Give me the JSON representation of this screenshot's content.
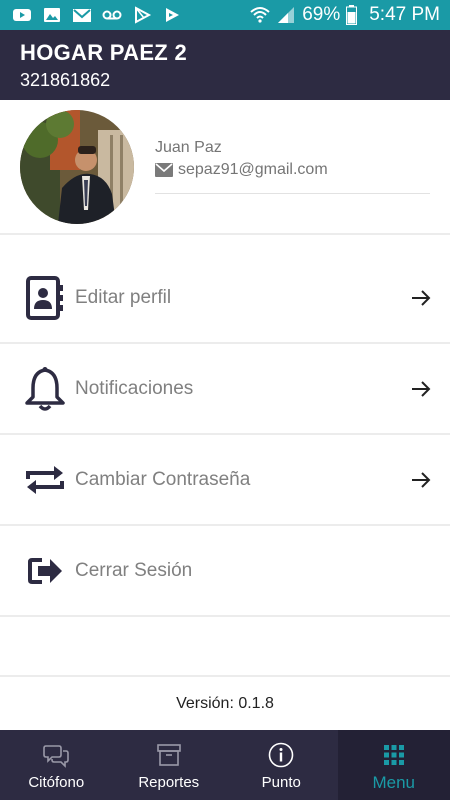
{
  "status_bar": {
    "battery": "69%",
    "time": "5:47 PM",
    "icons": [
      "youtube-icon",
      "image-icon",
      "gmail-icon",
      "voicemail-icon",
      "play-store-icon",
      "play-store-alt-icon",
      "wifi-icon",
      "signal-icon",
      "battery-icon"
    ]
  },
  "header": {
    "title": "HOGAR PAEZ 2",
    "subtitle": "321861862"
  },
  "profile": {
    "name": "Juan Paz",
    "email": "sepaz91@gmail.com"
  },
  "menu": {
    "items": [
      {
        "label": "Editar perfil",
        "icon": "contact-book-icon",
        "has_arrow": true
      },
      {
        "label": "Notificaciones",
        "icon": "bell-icon",
        "has_arrow": true
      },
      {
        "label": "Cambiar Contraseña",
        "icon": "swap-arrows-icon",
        "has_arrow": true
      },
      {
        "label": "Cerrar Sesión",
        "icon": "sign-out-icon",
        "has_arrow": false
      }
    ]
  },
  "version": "Versión: 0.1.8",
  "bottom_nav": {
    "items": [
      {
        "label": "Citófono",
        "icon": "chat-bubbles-icon",
        "active": false
      },
      {
        "label": "Reportes",
        "icon": "archive-box-icon",
        "active": false
      },
      {
        "label": "Punto",
        "icon": "info-circle-icon",
        "active": false
      },
      {
        "label": "Menu",
        "icon": "grid-icon",
        "active": true
      }
    ]
  },
  "colors": {
    "status_bar": "#1a9aa6",
    "header": "#2d2b42",
    "accent": "#1a9aa6",
    "icon_dark": "#2d2b42"
  }
}
